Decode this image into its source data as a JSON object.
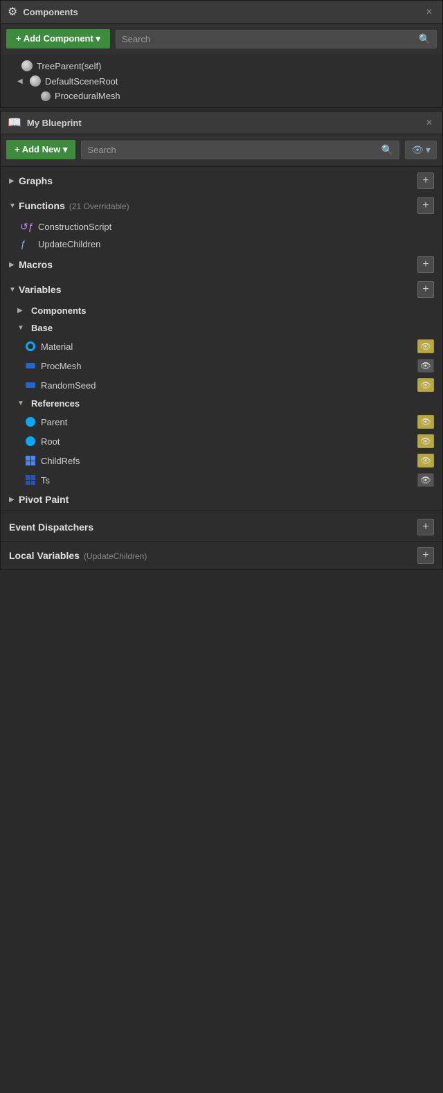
{
  "components_panel": {
    "title": "Components",
    "add_component_label": "+ Add Component ▾",
    "search_placeholder": "Search",
    "tree": [
      {
        "id": "tree-parent",
        "label": "TreeParent(self)",
        "indent": 0,
        "icon": "sphere",
        "arrow": ""
      },
      {
        "id": "default-scene-root",
        "label": "DefaultSceneRoot",
        "indent": 1,
        "icon": "sphere",
        "arrow": "◀"
      },
      {
        "id": "procedural-mesh",
        "label": "ProceduralMesh",
        "indent": 2,
        "icon": "sphere-small",
        "arrow": ""
      }
    ]
  },
  "my_blueprint_panel": {
    "title": "My Blueprint",
    "add_new_label": "+ Add New ▾",
    "search_placeholder": "Search",
    "sections": [
      {
        "id": "graphs",
        "label": "Graphs",
        "subtitle": "",
        "collapsed": true,
        "arrow": "▶",
        "has_add": true
      },
      {
        "id": "functions",
        "label": "Functions",
        "subtitle": "(21 Overridable)",
        "collapsed": false,
        "arrow": "▼",
        "has_add": true,
        "items": [
          {
            "id": "construction-script",
            "label": "ConstructionScript",
            "icon": "func-special"
          },
          {
            "id": "update-children",
            "label": "UpdateChildren",
            "icon": "func"
          }
        ]
      },
      {
        "id": "macros",
        "label": "Macros",
        "subtitle": "",
        "collapsed": true,
        "arrow": "▶",
        "has_add": true
      },
      {
        "id": "variables",
        "label": "Variables",
        "subtitle": "",
        "collapsed": false,
        "arrow": "▼",
        "has_add": true,
        "groups": [
          {
            "id": "components-group",
            "label": "Components",
            "arrow": "▶",
            "items": []
          },
          {
            "id": "base-group",
            "label": "Base",
            "arrow": "▼",
            "items": [
              {
                "id": "material",
                "label": "Material",
                "dot": "ring",
                "eye": "yellow"
              },
              {
                "id": "proc-mesh",
                "label": "ProcMesh",
                "dot": "blue-rect",
                "eye": "dark"
              },
              {
                "id": "random-seed",
                "label": "RandomSeed",
                "dot": "blue-rect",
                "eye": "yellow"
              }
            ]
          },
          {
            "id": "references-group",
            "label": "References",
            "arrow": "▼",
            "items": [
              {
                "id": "parent",
                "label": "Parent",
                "dot": "cyan",
                "eye": "yellow"
              },
              {
                "id": "root",
                "label": "Root",
                "dot": "cyan",
                "eye": "yellow"
              },
              {
                "id": "child-refs",
                "label": "ChildRefs",
                "dot": "grid",
                "eye": "yellow"
              },
              {
                "id": "ts",
                "label": "Ts",
                "dot": "grid-dark",
                "eye": "dark"
              }
            ]
          }
        ]
      },
      {
        "id": "pivot-paint",
        "label": "Pivot Paint",
        "subtitle": "",
        "collapsed": true,
        "arrow": "▶",
        "has_add": false
      }
    ],
    "bottom_sections": [
      {
        "id": "event-dispatchers",
        "label": "Event Dispatchers",
        "has_add": true
      },
      {
        "id": "local-variables",
        "label": "Local Variables",
        "subtitle": "(UpdateChildren)",
        "has_add": true
      }
    ]
  },
  "icons": {
    "search": "🔍",
    "add": "+",
    "close": "✕",
    "eye_open": "👁",
    "chevron_down": "▾",
    "book": "📖"
  }
}
